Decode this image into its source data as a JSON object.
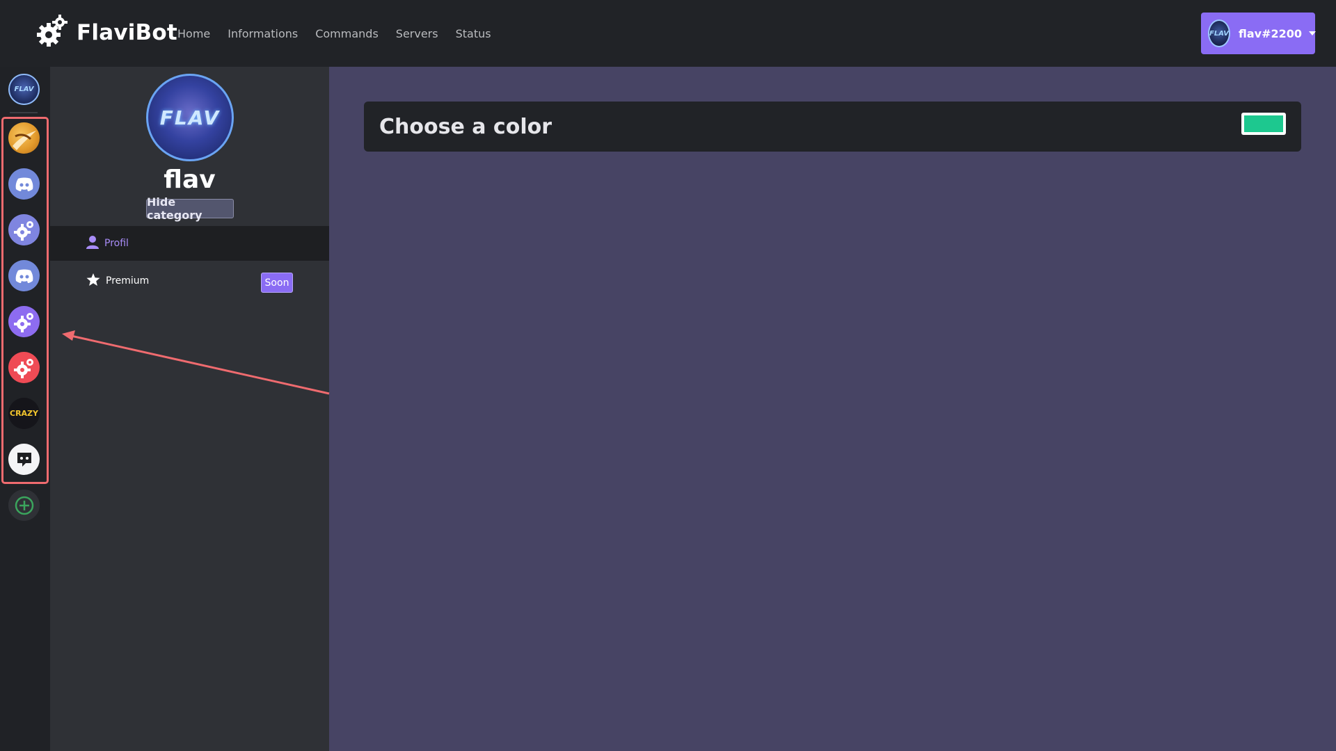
{
  "navbar": {
    "brand": "FlaviBot",
    "links": [
      "Home",
      "Informations",
      "Commands",
      "Servers",
      "Status"
    ],
    "user": {
      "name": "flav#2200"
    }
  },
  "rail": {
    "crazy_label": "CRAZY"
  },
  "profile": {
    "avatar_text": "FLAV",
    "name": "flav",
    "hide_label": "Hide category"
  },
  "menu": [
    {
      "label": "Profil",
      "icon": "user-icon",
      "active": true
    },
    {
      "label": "Premium",
      "icon": "star-icon",
      "badge": "Soon"
    }
  ],
  "content": {
    "title": "Choose a color",
    "color": "#1dc88f"
  },
  "colors": {
    "accent": "#8a6cf4",
    "highlight": "#ef6b6f",
    "background": "#474464"
  }
}
